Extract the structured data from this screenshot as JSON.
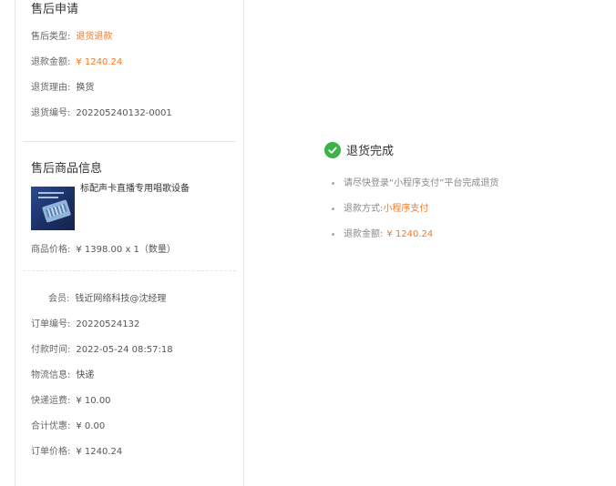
{
  "application": {
    "title": "售后申请",
    "type_label": "售后类型:",
    "type_value": "退货退款",
    "amount_label": "退款金额:",
    "amount_value": "¥ 1240.24",
    "reason_label": "退货理由:",
    "reason_value": "换货",
    "number_label": "退货编号:",
    "number_value": "202205240132-0001"
  },
  "product": {
    "title": "售后商品信息",
    "name": "标配声卡直播专用唱歌设备",
    "price_label": "商品价格:",
    "price_value": "¥ 1398.00 x 1（数量）"
  },
  "order": {
    "member_label": "会员:",
    "member_value": "钱近网络科技@沈经理",
    "order_no_label": "订单编号:",
    "order_no_value": "20220524132",
    "pay_time_label": "付款时间:",
    "pay_time_value": "2022-05-24 08:57:18",
    "logistics_label": "物流信息:",
    "logistics_value": "快递",
    "shipping_label": "快递运费:",
    "shipping_value": "¥ 10.00",
    "discount_label": "合计优惠:",
    "discount_value": "¥ 0.00",
    "total_label": "订单价格:",
    "total_value": "¥ 1240.24"
  },
  "status": {
    "icon": "check-circle-icon",
    "text": "退货完成",
    "hint": "请尽快登录“小程序支付”平台完成退货",
    "method_label": "退款方式:",
    "method_value": "小程序支付",
    "amount_label": "退款金额:",
    "amount_value": "¥ 1240.24"
  },
  "colors": {
    "accent_orange": "#f07a2a",
    "success_green": "#3bb346"
  }
}
